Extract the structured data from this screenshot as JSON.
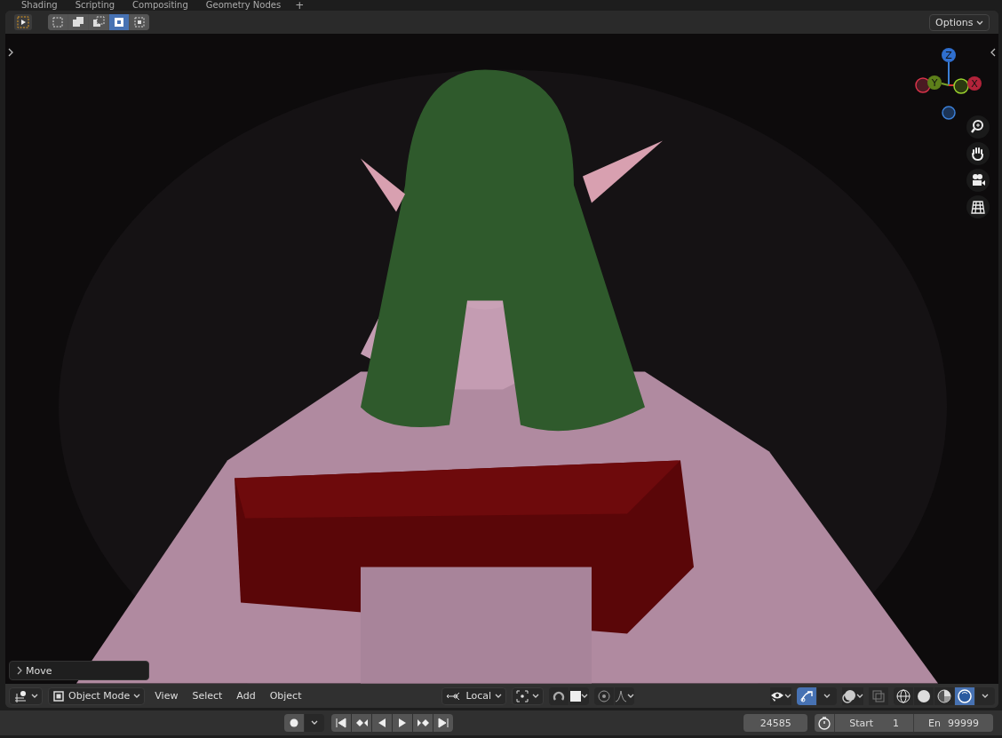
{
  "workspace_tabs": [
    {
      "label": "Shading",
      "selected": false
    },
    {
      "label": "Scripting",
      "selected": false
    },
    {
      "label": "Compositing",
      "selected": false
    },
    {
      "label": "Geometry Nodes",
      "selected": false
    }
  ],
  "add_tab": "+",
  "tool_header": {
    "selection_modes": [
      {
        "kind": "set",
        "selected": false
      },
      {
        "kind": "extend",
        "selected": false
      },
      {
        "kind": "subtract",
        "selected": false
      },
      {
        "kind": "difference",
        "selected": true
      },
      {
        "kind": "intersect",
        "selected": false
      }
    ],
    "options": "Options"
  },
  "viewport": {
    "kind": "picture",
    "gizmo_axes": [
      "Z",
      "Y",
      "X"
    ],
    "last_operator": "Move"
  },
  "viewport_header": {
    "mode": "Object Mode",
    "menus": [
      "View",
      "Select",
      "Add",
      "Object"
    ],
    "orientation": "Local",
    "gizmos_on": true,
    "shading_modes": [
      {
        "kind": "wireframe",
        "selected": false
      },
      {
        "kind": "solid",
        "selected": false
      },
      {
        "kind": "material",
        "selected": false
      },
      {
        "kind": "rendered",
        "selected": true
      }
    ]
  },
  "timeline": {
    "current_frame": "24585",
    "start_label": "Start",
    "start": "1",
    "end_label": "En",
    "end": "99999"
  }
}
